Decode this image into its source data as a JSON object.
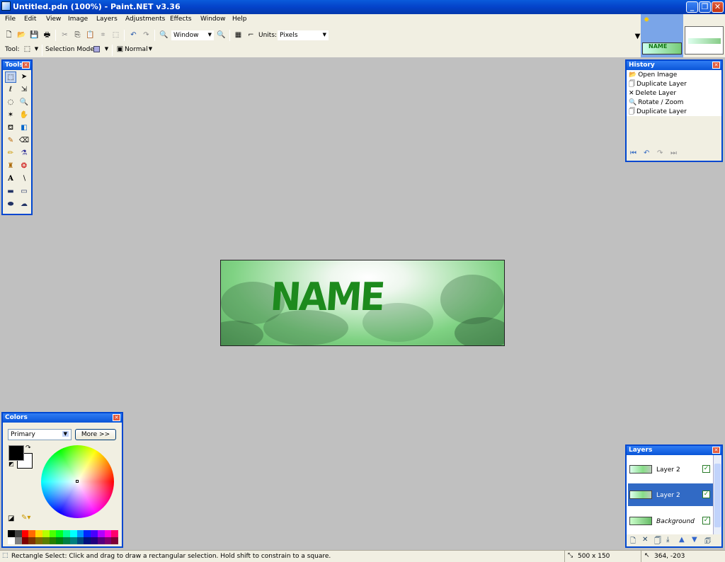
{
  "window": {
    "title": "Untitled.pdn (100%) - Paint.NET v3.36"
  },
  "menu": [
    "File",
    "Edit",
    "View",
    "Image",
    "Layers",
    "Adjustments",
    "Effects",
    "Window",
    "Help"
  ],
  "toolbar": {
    "zoom_value": "Window",
    "units_label": "Units:",
    "units_value": "Pixels"
  },
  "toolbar2": {
    "tool_label": "Tool:",
    "selection_mode_label": "Selection Mode:",
    "blend_value": "Normal"
  },
  "tools_panel": {
    "title": "Tools"
  },
  "history_panel": {
    "title": "History",
    "items": [
      "Open Image",
      "Duplicate Layer",
      "Delete Layer",
      "Rotate / Zoom",
      "Duplicate Layer"
    ]
  },
  "colors_panel": {
    "title": "Colors",
    "mode": "Primary",
    "more_button": "More >>",
    "palette": [
      "#000000",
      "#404040",
      "#ff0000",
      "#ff6a00",
      "#ffd800",
      "#b6ff00",
      "#4cff00",
      "#00ff21",
      "#00ff90",
      "#00ffff",
      "#0094ff",
      "#0026ff",
      "#4800ff",
      "#b200ff",
      "#ff00dc",
      "#ff006e",
      "#ffffff",
      "#808080",
      "#7f0000",
      "#7f3300",
      "#7f6a00",
      "#5b7f00",
      "#267f00",
      "#007f0e",
      "#007f46",
      "#007f7f",
      "#004a7f",
      "#00137f",
      "#21007f",
      "#57007f",
      "#7f006e",
      "#7f0037"
    ]
  },
  "layers_panel": {
    "title": "Layers",
    "layers": [
      {
        "name": "Layer 2",
        "selected": false
      },
      {
        "name": "Layer 2",
        "selected": true
      },
      {
        "name": "Background",
        "selected": false
      }
    ]
  },
  "canvas": {
    "text": "NAME"
  },
  "status": {
    "hint": "Rectangle Select: Click and drag to draw a rectangular selection. Hold shift to constrain to a square.",
    "size": "500 x 150",
    "cursor": "364, -203"
  }
}
